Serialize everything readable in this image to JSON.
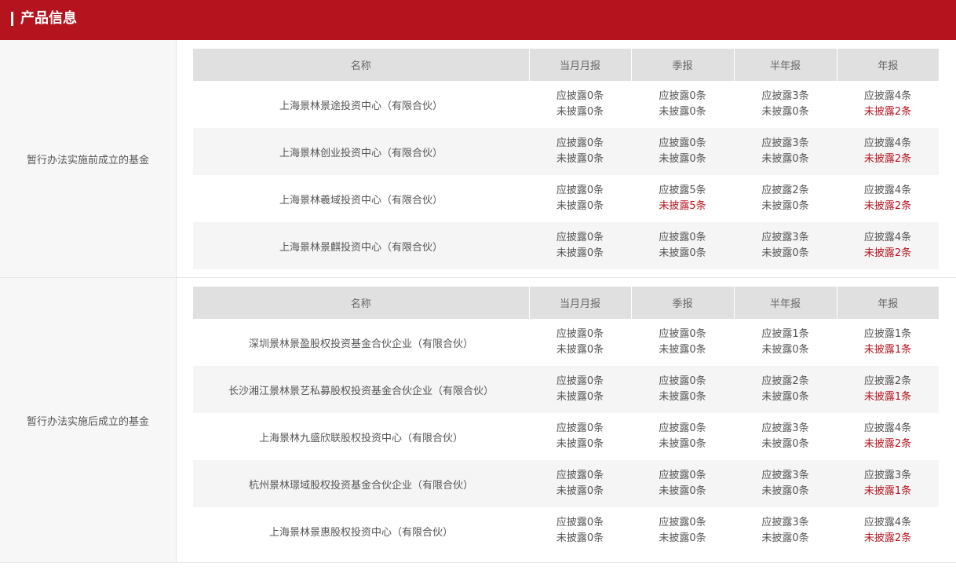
{
  "header": {
    "title": "产品信息"
  },
  "columns": [
    "名称",
    "当月月报",
    "季报",
    "半年报",
    "年报"
  ],
  "groups": [
    {
      "label": "暂行办法实施前成立的基金",
      "rows": [
        {
          "name": "上海景林景途投资中心（有限合伙）",
          "cells": [
            [
              "应披露0条",
              "未披露0条"
            ],
            [
              "应披露0条",
              "未披露0条"
            ],
            [
              "应披露3条",
              "未披露0条"
            ],
            [
              "应披露4条",
              "未披露2条"
            ]
          ]
        },
        {
          "name": "上海景林创业投资中心（有限合伙）",
          "cells": [
            [
              "应披露0条",
              "未披露0条"
            ],
            [
              "应披露0条",
              "未披露0条"
            ],
            [
              "应披露3条",
              "未披露0条"
            ],
            [
              "应披露4条",
              "未披露2条"
            ]
          ]
        },
        {
          "name": "上海景林羲域投资中心（有限合伙）",
          "cells": [
            [
              "应披露0条",
              "未披露0条"
            ],
            [
              "应披露5条",
              "未披露5条"
            ],
            [
              "应披露2条",
              "未披露0条"
            ],
            [
              "应披露4条",
              "未披露2条"
            ]
          ]
        },
        {
          "name": "上海景林景麒投资中心（有限合伙）",
          "cells": [
            [
              "应披露0条",
              "未披露0条"
            ],
            [
              "应披露0条",
              "未披露0条"
            ],
            [
              "应披露3条",
              "未披露0条"
            ],
            [
              "应披露4条",
              "未披露2条"
            ]
          ]
        }
      ]
    },
    {
      "label": "暂行办法实施后成立的基金",
      "rows": [
        {
          "name": "深圳景林景盈股权投资基金合伙企业（有限合伙）",
          "cells": [
            [
              "应披露0条",
              "未披露0条"
            ],
            [
              "应披露0条",
              "未披露0条"
            ],
            [
              "应披露1条",
              "未披露0条"
            ],
            [
              "应披露1条",
              "未披露1条"
            ]
          ]
        },
        {
          "name": "长沙湘江景林景艺私募股权投资基金合伙企业（有限合伙）",
          "cells": [
            [
              "应披露0条",
              "未披露0条"
            ],
            [
              "应披露0条",
              "未披露0条"
            ],
            [
              "应披露2条",
              "未披露0条"
            ],
            [
              "应披露2条",
              "未披露1条"
            ]
          ]
        },
        {
          "name": "上海景林九盛欣联股权投资中心（有限合伙）",
          "cells": [
            [
              "应披露0条",
              "未披露0条"
            ],
            [
              "应披露0条",
              "未披露0条"
            ],
            [
              "应披露3条",
              "未披露0条"
            ],
            [
              "应披露4条",
              "未披露2条"
            ]
          ]
        },
        {
          "name": "杭州景林璟域股权投资基金合伙企业（有限合伙）",
          "cells": [
            [
              "应披露0条",
              "未披露0条"
            ],
            [
              "应披露0条",
              "未披露0条"
            ],
            [
              "应披露3条",
              "未披露0条"
            ],
            [
              "应披露3条",
              "未披露1条"
            ]
          ]
        },
        {
          "name": "上海景林景惠股权投资中心（有限合伙）",
          "cells": [
            [
              "应披露0条",
              "未披露0条"
            ],
            [
              "应披露0条",
              "未披露0条"
            ],
            [
              "应披露3条",
              "未披露0条"
            ],
            [
              "应披露4条",
              "未披露2条"
            ]
          ]
        }
      ]
    }
  ]
}
